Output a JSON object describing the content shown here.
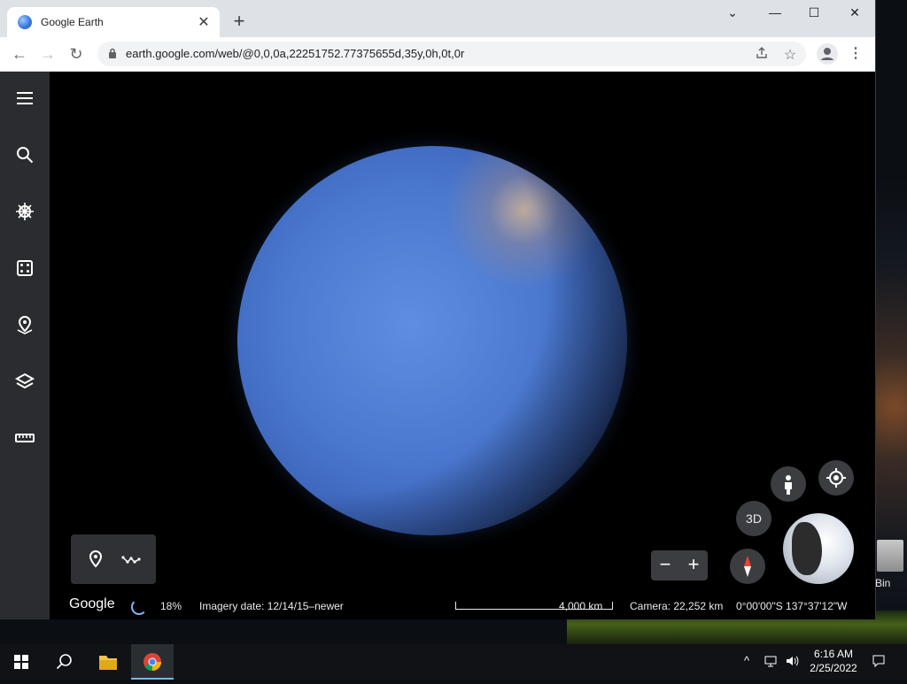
{
  "browser": {
    "tab_title": "Google Earth",
    "url": "earth.google.com/web/@0,0,0a,22251752.77375655d,35y,0h,0t,0r",
    "controls": {
      "minimize": "—",
      "maximize": "☐",
      "close": "✕",
      "tab_list": "⌄",
      "new_tab": "+"
    }
  },
  "earth": {
    "sidebar_icons": [
      "menu-icon",
      "search-icon",
      "voyager-icon",
      "feeling-lucky-icon",
      "projects-icon",
      "map-style-icon",
      "measure-icon"
    ],
    "three_d_label": "3D",
    "zoom_out": "−",
    "zoom_in": "+",
    "status": {
      "logo": "Google",
      "load_progress": "18%",
      "imagery_date": "Imagery date: 12/14/15–newer",
      "scale": "4,000 km",
      "camera": "Camera: 22,252 km",
      "coordinates": "0°00'00\"S 137°37'12\"W"
    }
  },
  "desktop": {
    "recycle_bin_label": "Bin"
  },
  "taskbar": {
    "time": "6:16 AM",
    "date": "2/25/2022",
    "apps": [
      "start-icon",
      "search-icon",
      "file-explorer-icon",
      "chrome-icon"
    ]
  }
}
